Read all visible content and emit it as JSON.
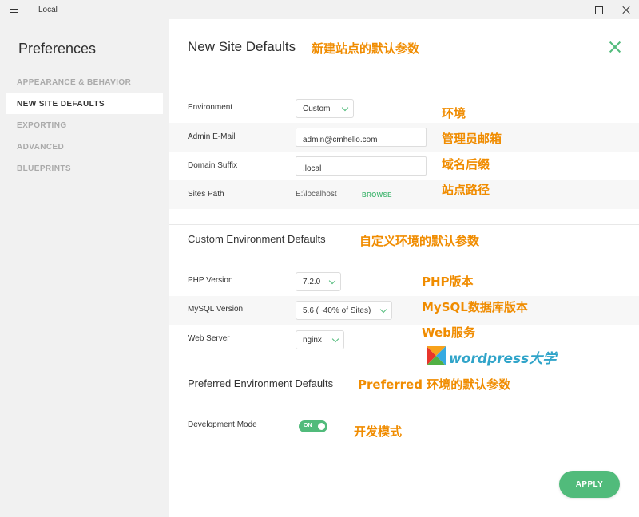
{
  "window": {
    "app_title": "Local"
  },
  "sidebar": {
    "title": "Preferences",
    "items": [
      {
        "label": "APPEARANCE & BEHAVIOR"
      },
      {
        "label": "NEW SITE DEFAULTS",
        "active": true
      },
      {
        "label": "EXPORTING"
      },
      {
        "label": "ADVANCED"
      },
      {
        "label": "BLUEPRINTS"
      }
    ]
  },
  "main": {
    "title": "New Site Defaults",
    "environment": {
      "label": "Environment",
      "value": "Custom"
    },
    "admin_email": {
      "label": "Admin E-Mail",
      "value": "admin@cmhello.com"
    },
    "domain_suffix": {
      "label": "Domain Suffix",
      "value": ".local"
    },
    "sites_path": {
      "label": "Sites Path",
      "value": "E:\\localhost",
      "browse": "BROWSE"
    },
    "custom_env": {
      "title": "Custom Environment Defaults",
      "php": {
        "label": "PHP Version",
        "value": "7.2.0"
      },
      "mysql": {
        "label": "MySQL Version",
        "value": "5.6 (~40% of Sites)"
      },
      "web_server": {
        "label": "Web Server",
        "value": "nginx"
      }
    },
    "preferred_env": {
      "title": "Preferred Environment Defaults",
      "dev_mode": {
        "label": "Development Mode",
        "toggle": "ON",
        "enabled": true
      }
    },
    "apply_label": "APPLY"
  },
  "annotations": {
    "title": "新建站点的默认参数",
    "environment": "环境",
    "admin_email": "管理员邮箱",
    "domain_suffix": "域名后缀",
    "sites_path": "站点路径",
    "custom_env": "自定义环境的默认参数",
    "php": "PHP版本",
    "mysql": "MySQL数据库版本",
    "web": "Web服务",
    "preferred": "Preferred 环境的默认参数",
    "dev_mode": "开发模式"
  },
  "watermark": {
    "text": "wordpress大学"
  },
  "colors": {
    "accent": "#51bb7b",
    "annotation": "#f08c00",
    "watermark": "#30a4c9"
  }
}
